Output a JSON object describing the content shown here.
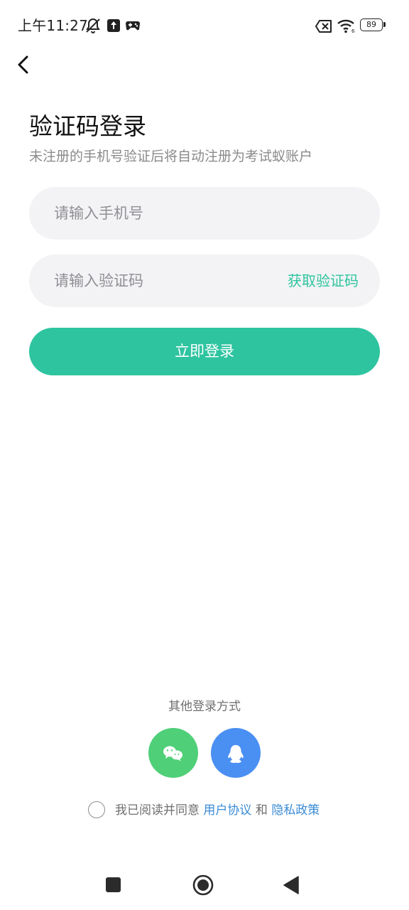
{
  "status_bar": {
    "time": "上午11:27",
    "battery": "89",
    "icons": [
      "mute-bell-icon",
      "upload-icon",
      "game-controller-icon",
      "no-sim-icon",
      "wifi-icon",
      "battery-icon"
    ]
  },
  "nav": {
    "back_icon": "back-chevron-icon"
  },
  "header": {
    "title": "验证码登录",
    "subtitle": "未注册的手机号验证后将自动注册为考试蚁账户"
  },
  "form": {
    "phone_placeholder": "请输入手机号",
    "phone_value": "",
    "code_placeholder": "请输入验证码",
    "code_value": "",
    "get_code_label": "获取验证码",
    "login_label": "立即登录"
  },
  "other_login": {
    "label": "其他登录方式",
    "providers": [
      {
        "name": "wechat",
        "icon": "wechat-icon",
        "color": "#4fcf78"
      },
      {
        "name": "qq",
        "icon": "qq-penguin-icon",
        "color": "#4a8ff2"
      }
    ]
  },
  "agreement": {
    "prefix": "我已阅读并同意",
    "user_agreement": "用户协议",
    "conjunction": "和",
    "privacy_policy": "隐私政策",
    "checked": false
  },
  "system_nav": {
    "buttons": [
      "recents-square-icon",
      "home-circle-icon",
      "back-triangle-icon"
    ]
  },
  "colors": {
    "accent": "#2ec4a0",
    "link": "#3a8bd6",
    "field_bg": "#f3f3f5"
  }
}
